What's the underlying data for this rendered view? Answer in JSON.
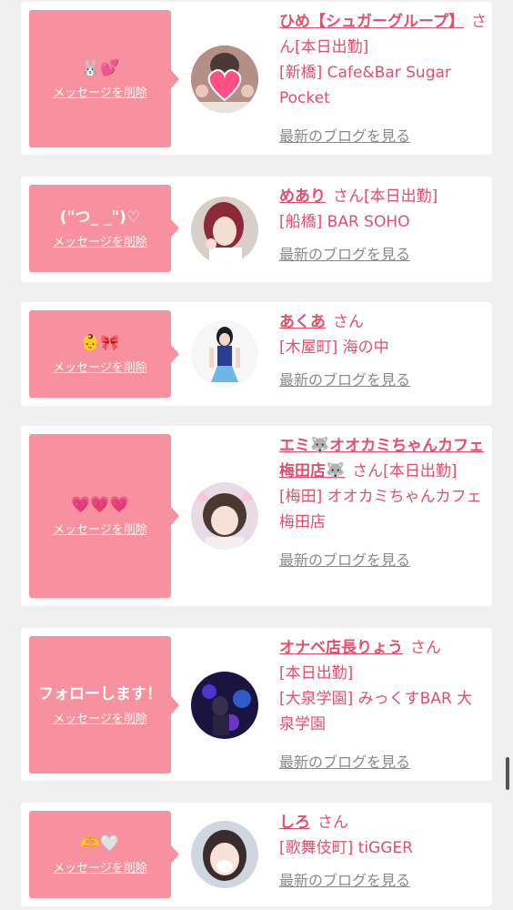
{
  "delete_label": "メッセージを削除",
  "blog_label": "最新のブログを見る",
  "colors": {
    "bubble": "#f7909f",
    "name_text": "#e0506e",
    "blog_link": "#8a8a8a",
    "card_bg": "#ffffff",
    "page_bg": "#f0f0f0"
  },
  "entries": [
    {
      "message": "🐰💕",
      "name": "ひめ【シュガーグループ】",
      "honorific": "さん",
      "status": "[本日出勤]",
      "location": "[新橋] Cafe&Bar Sugar Pocket"
    },
    {
      "message": "(\"つ_ _\")♡",
      "name": "めあり",
      "honorific": "さん",
      "status": "[本日出勤]",
      "location": "[船橋] BAR SOHO"
    },
    {
      "message": "👶🎀",
      "name": "あくあ",
      "honorific": "さん",
      "status": "",
      "location": "[木屋町] 海の中"
    },
    {
      "message": "💗💗💗",
      "name": "エミ🐺オオカミちゃんカフェ梅田店🐺",
      "honorific": "さん",
      "status": "[本日出勤]",
      "location": "[梅田] オオカミちゃんカフェ梅田店"
    },
    {
      "message": "フォローします！",
      "name": "オナベ店長りょう",
      "honorific": "さん",
      "status": "[本日出勤]",
      "location": "[大泉学園] みっくすBAR 大泉学園"
    },
    {
      "message": "🫶🤍",
      "name": "しろ",
      "honorific": "さん",
      "status": "",
      "location": "[歌舞伎町] tiGGER"
    }
  ]
}
